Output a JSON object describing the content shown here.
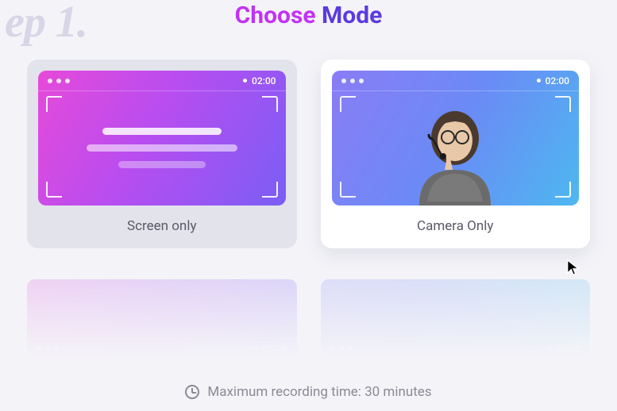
{
  "step_bg": "ep 1.",
  "title": {
    "choose": "Choose",
    "mode": "Mode"
  },
  "timer": "02:00",
  "cards": {
    "screen": {
      "label": "Screen only"
    },
    "camera": {
      "label": "Camera Only"
    }
  },
  "footer": "Maximum recording time: 30 minutes"
}
